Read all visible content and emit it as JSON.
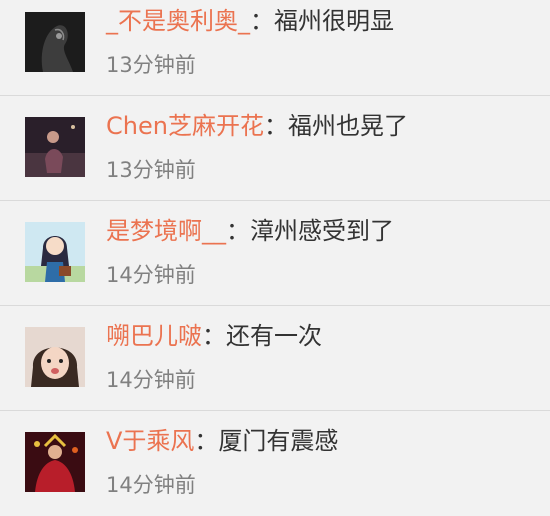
{
  "comments": [
    {
      "username": "_不是奥利奥_",
      "separator": "：",
      "text": "福州很明显",
      "time": "13分钟前",
      "avatar_icon": "dark-silhouette-avatar"
    },
    {
      "username": "Chen芝麻开花",
      "separator": "：",
      "text": "福州也晃了",
      "time": "13分钟前",
      "avatar_icon": "night-figure-avatar"
    },
    {
      "username": "是梦境啊__",
      "separator": "：",
      "text": "漳州感受到了",
      "time": "14分钟前",
      "avatar_icon": "cartoon-girl-avatar"
    },
    {
      "username": "嗍巴儿啵",
      "separator": "：",
      "text": "还有一次",
      "time": "14分钟前",
      "avatar_icon": "child-photo-avatar"
    },
    {
      "username": "V于乘风",
      "separator": "：",
      "text": "厦门有震感",
      "time": "14分钟前",
      "avatar_icon": "red-performer-avatar"
    }
  ],
  "colors": {
    "username": "#eb7350",
    "text": "#333333",
    "time": "#808080",
    "background": "#f2f2f2"
  }
}
